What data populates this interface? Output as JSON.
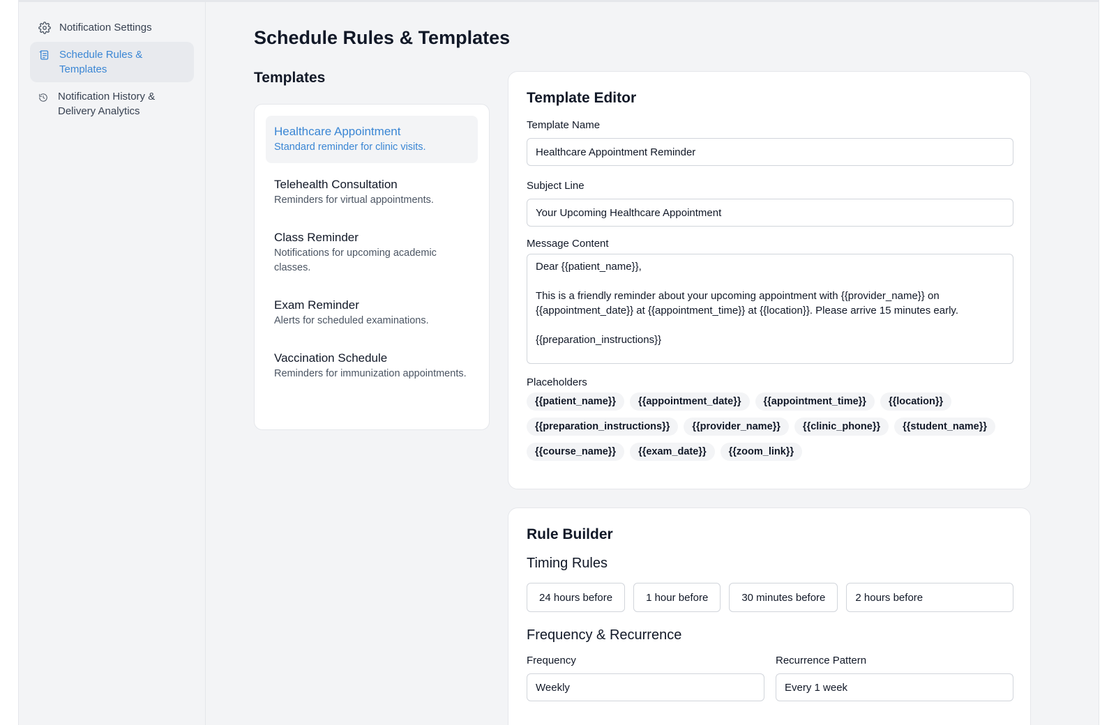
{
  "sidebar": {
    "items": [
      {
        "label": "Notification Settings",
        "icon": "gear-icon",
        "active": false
      },
      {
        "label": "Schedule Rules & Templates",
        "icon": "document-icon",
        "active": true
      },
      {
        "label": "Notification History & Delivery Analytics",
        "icon": "history-icon",
        "active": false
      }
    ]
  },
  "page": {
    "title": "Schedule Rules & Templates"
  },
  "templates": {
    "section_title": "Templates",
    "items": [
      {
        "name": "Healthcare Appointment",
        "description": "Standard reminder for clinic visits.",
        "active": true
      },
      {
        "name": "Telehealth Consultation",
        "description": "Reminders for virtual appointments.",
        "active": false
      },
      {
        "name": "Class Reminder",
        "description": "Notifications for upcoming academic classes.",
        "active": false
      },
      {
        "name": "Exam Reminder",
        "description": "Alerts for scheduled examinations.",
        "active": false
      },
      {
        "name": "Vaccination Schedule",
        "description": "Reminders for immunization appointments.",
        "active": false
      }
    ]
  },
  "editor": {
    "title": "Template Editor",
    "template_name_label": "Template Name",
    "template_name_value": "Healthcare Appointment Reminder",
    "subject_label": "Subject Line",
    "subject_value": "Your Upcoming Healthcare Appointment",
    "message_label": "Message Content",
    "message_value": "Dear {{patient_name}},\n\nThis is a friendly reminder about your upcoming appointment with {{provider_name}} on {{appointment_date}} at {{appointment_time}} at {{location}}. Please arrive 15 minutes early.\n\n{{preparation_instructions}}",
    "placeholders_label": "Placeholders",
    "placeholders": [
      "{{patient_name}}",
      "{{appointment_date}}",
      "{{appointment_time}}",
      "{{location}}",
      "{{preparation_instructions}}",
      "{{provider_name}}",
      "{{clinic_phone}}",
      "{{student_name}}",
      "{{course_name}}",
      "{{exam_date}}",
      "{{zoom_link}}"
    ]
  },
  "rules": {
    "title": "Rule Builder",
    "timing_title": "Timing Rules",
    "timing_options": [
      "24 hours before",
      "1 hour before",
      "30 minutes before"
    ],
    "timing_custom_value": "2 hours before",
    "recurrence_title": "Frequency & Recurrence",
    "frequency_label": "Frequency",
    "frequency_value": "Weekly",
    "pattern_label": "Recurrence Pattern",
    "pattern_value": "Every 1 week"
  },
  "colors": {
    "accent": "#3a86d4",
    "background": "#f3f4f6",
    "card": "#ffffff",
    "border": "#e5e7eb"
  }
}
